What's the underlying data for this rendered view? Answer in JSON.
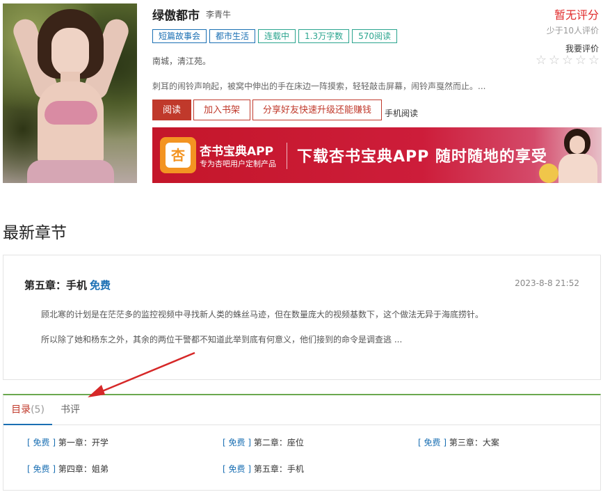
{
  "book": {
    "title": "绿傲都市",
    "author": "李青牛",
    "tags": [
      {
        "label": "短篇故事会",
        "style": "blue"
      },
      {
        "label": "都市生活",
        "style": "blue"
      },
      {
        "label": "连载中",
        "style": "green"
      },
      {
        "label": "1.3万字数",
        "style": "green"
      },
      {
        "label": "570阅读",
        "style": "green"
      }
    ],
    "location": "南城，清江苑。",
    "intro": "刺耳的闹铃声响起，被窝中伸出的手在床边一阵摸索，轻轻敲击屏幕，闹铃声戛然而止。..."
  },
  "actions": {
    "read": "阅读",
    "add_shelf": "加入书架",
    "share": "分享好友快速升级还能赚钱",
    "mobile_read": "手机阅读"
  },
  "banner": {
    "logo_char": "杏",
    "app_name": "杏书宝典APP",
    "app_sub": "专为杏吧用户定制产品",
    "slogan": "下载杏书宝典APP 随时随地的享受"
  },
  "rating": {
    "status": "暂无评分",
    "count_text": "少于10人评价",
    "rate_label": "我要评价",
    "stars": [
      "☆",
      "☆",
      "☆",
      "☆",
      "☆"
    ],
    "filled": 0
  },
  "latest": {
    "section_title": "最新章节",
    "chapter_title": "第五章：手机",
    "free_label": "免费",
    "time": "2023-8-8 21:52",
    "p1": "顾北寒的计划是在茫茫多的监控视频中寻找新人类的蛛丝马迹，但在数量庞大的视频基数下，这个做法无异于海底捞针。",
    "p2": "所以除了她和杨东之外，其余的两位干警都不知道此举到底有何意义，他们接到的命令是调查逃 ..."
  },
  "toc": {
    "tab_catalog": "目录",
    "tab_catalog_count": "(5)",
    "tab_review": "书评",
    "items": [
      {
        "tag": "免费",
        "title": "第一章：开学"
      },
      {
        "tag": "免费",
        "title": "第二章：座位"
      },
      {
        "tag": "免费",
        "title": "第三章：大案"
      },
      {
        "tag": "免费",
        "title": "第四章：姐弟"
      },
      {
        "tag": "免费",
        "title": "第五章：手机"
      }
    ]
  },
  "colors": {
    "accent_red": "#c0392b",
    "link_blue": "#1a6fb3",
    "tag_green": "#2aa48e",
    "tab_border_green": "#6aa84f",
    "annotation_arrow": "#d62828"
  }
}
